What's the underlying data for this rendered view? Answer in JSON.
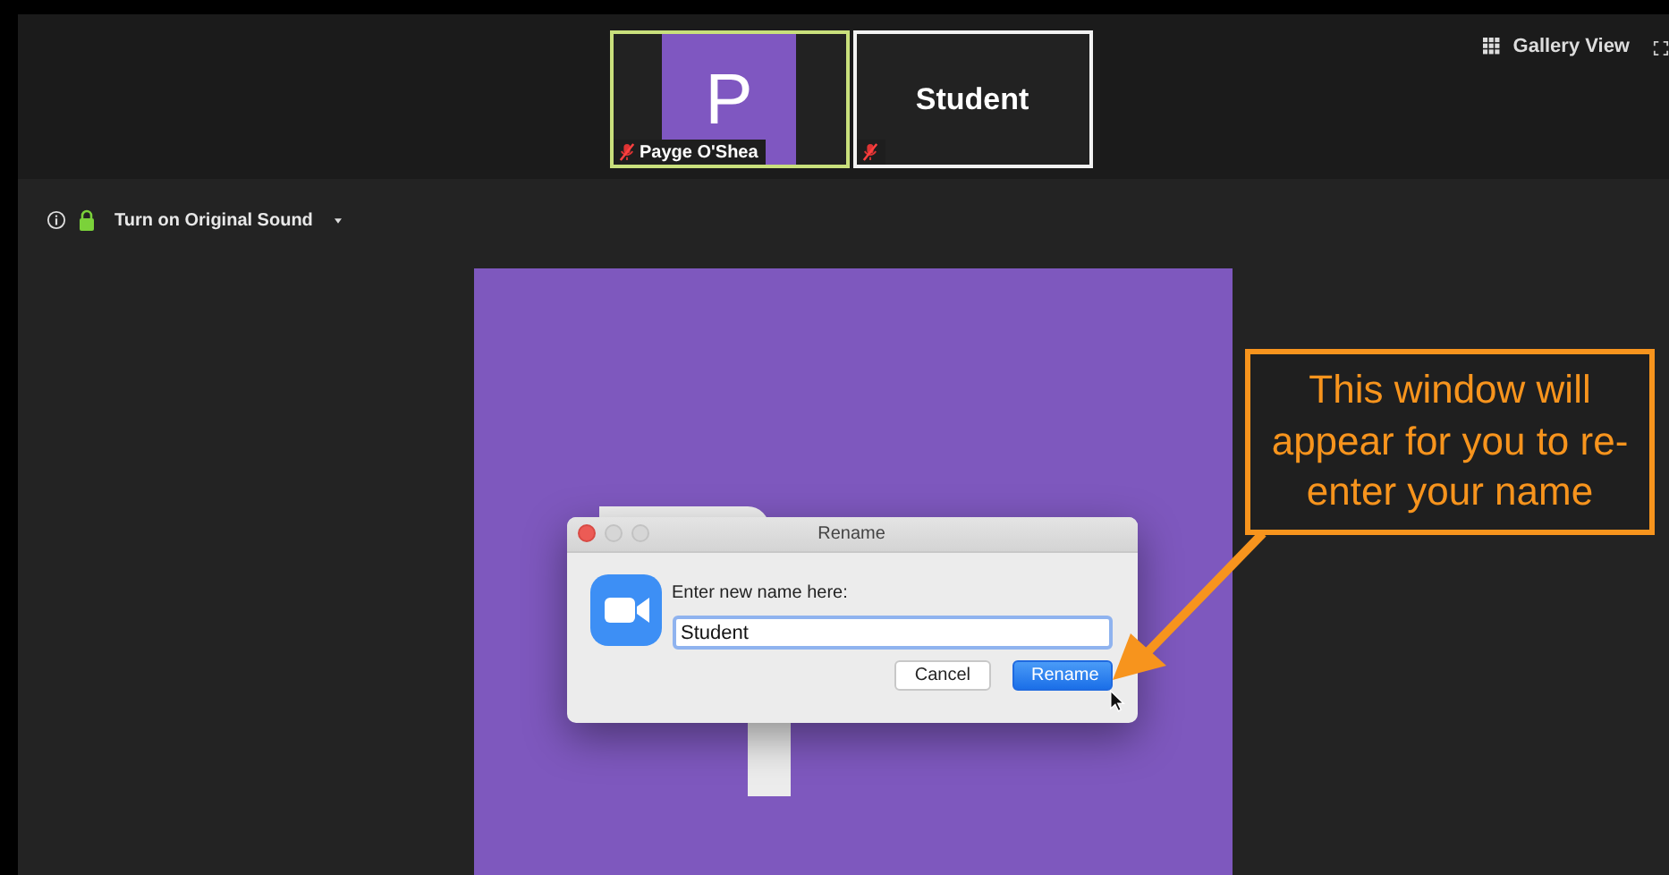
{
  "participants": [
    {
      "kind": "avatar",
      "letter": "P",
      "name": "Payge O'Shea",
      "active_speaker": true,
      "muted": true
    },
    {
      "kind": "name",
      "display": "Student",
      "active_speaker": false,
      "muted": true
    }
  ],
  "view_button": {
    "label": "Gallery View"
  },
  "audio_bar": {
    "label": "Turn on Original Sound"
  },
  "dialog": {
    "title": "Rename",
    "prompt": "Enter new name here:",
    "value": "Student",
    "buttons": [
      {
        "label": "Cancel",
        "kind": "secondary"
      },
      {
        "label": "Rename",
        "kind": "primary"
      }
    ]
  },
  "callout": {
    "text": "This window will appear for you to re-enter your name"
  }
}
